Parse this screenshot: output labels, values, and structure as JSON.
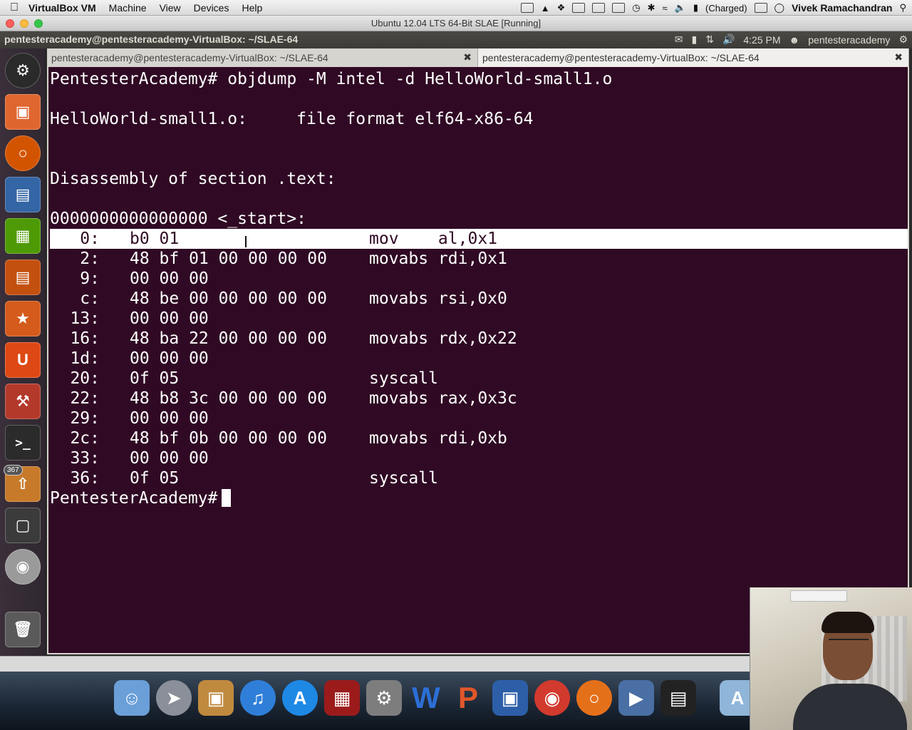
{
  "mac_menubar": {
    "app_name": "VirtualBox VM",
    "menus": [
      "Machine",
      "View",
      "Devices",
      "Help"
    ],
    "battery_text": "(Charged)",
    "user_name": "Vivek Ramachandran"
  },
  "vbox_window": {
    "title": "Ubuntu 12.04 LTS 64-Bit SLAE [Running]"
  },
  "ubuntu_panel": {
    "window_title": "pentesteracademy@pentesteracademy-VirtualBox: ~/SLAE-64",
    "time": "4:25 PM",
    "user": "pentesteracademy"
  },
  "launcher": {
    "badge_count": "367"
  },
  "terminal": {
    "tabs": [
      {
        "label": "pentesteracademy@pentesteracademy-VirtualBox: ~/SLAE-64",
        "active": false
      },
      {
        "label": "pentesteracademy@pentesteracademy-VirtualBox: ~/SLAE-64",
        "active": true
      }
    ],
    "command_line": "PentesterAcademy# objdump -M intel -d HelloWorld-small1.o",
    "file_format_line": "HelloWorld-small1.o:     file format elf64-x86-64",
    "section_line": "Disassembly of section .text:",
    "symbol_line": "0000000000000000 <_start>:",
    "disasm": [
      {
        "addr": "0:",
        "bytes": "b0 01",
        "instr": "mov    al,0x1"
      },
      {
        "addr": "2:",
        "bytes": "48 bf 01 00 00 00 00",
        "instr": "movabs rdi,0x1"
      },
      {
        "addr": "9:",
        "bytes": "00 00 00",
        "instr": ""
      },
      {
        "addr": "c:",
        "bytes": "48 be 00 00 00 00 00",
        "instr": "movabs rsi,0x0"
      },
      {
        "addr": "13:",
        "bytes": "00 00 00",
        "instr": ""
      },
      {
        "addr": "16:",
        "bytes": "48 ba 22 00 00 00 00",
        "instr": "movabs rdx,0x22"
      },
      {
        "addr": "1d:",
        "bytes": "00 00 00",
        "instr": ""
      },
      {
        "addr": "20:",
        "bytes": "0f 05",
        "instr": "syscall"
      },
      {
        "addr": "22:",
        "bytes": "48 b8 3c 00 00 00 00",
        "instr": "movabs rax,0x3c"
      },
      {
        "addr": "29:",
        "bytes": "00 00 00",
        "instr": ""
      },
      {
        "addr": "2c:",
        "bytes": "48 bf 0b 00 00 00 00",
        "instr": "movabs rdi,0xb"
      },
      {
        "addr": "33:",
        "bytes": "00 00 00",
        "instr": ""
      },
      {
        "addr": "36:",
        "bytes": "0f 05",
        "instr": "syscall"
      }
    ],
    "prompt": "PentesterAcademy#"
  },
  "colors": {
    "terminal_bg": "#300a24",
    "terminal_fg": "#ffffff",
    "panel_bg": "#3c3b37"
  }
}
